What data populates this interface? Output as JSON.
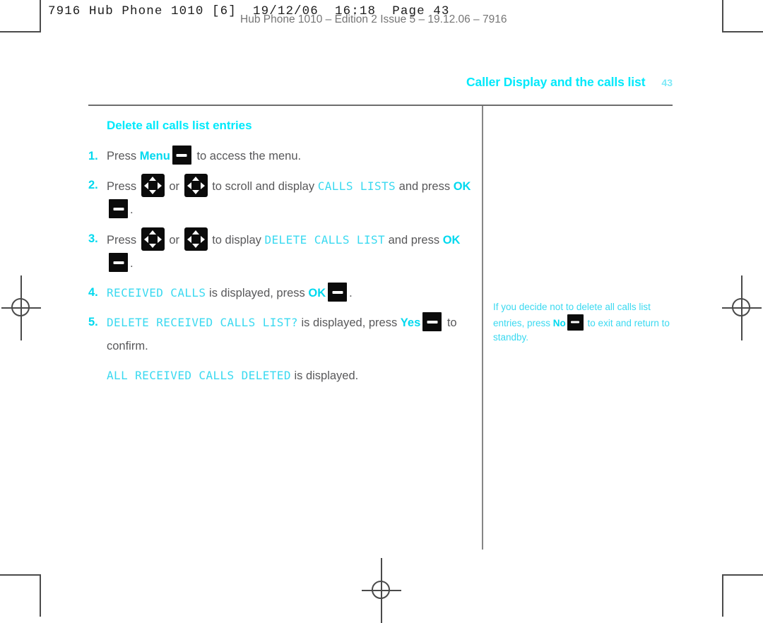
{
  "printer_slug": "7916 Hub Phone 1010 [6]  19/12/06  16:18  Page 43",
  "footer_ghost": "Hub Phone 1010 – Edition 2 Issue 5 – 19.12.06 – 7916",
  "running_head": {
    "title": "Caller Display and the calls list",
    "folio": "43"
  },
  "section": {
    "title": "Delete all calls list entries"
  },
  "steps": [
    {
      "number": "1.",
      "parts": [
        {
          "type": "text",
          "value": "Press "
        },
        {
          "type": "em",
          "value": "Menu"
        },
        {
          "type": "key",
          "value": "flat-key"
        },
        {
          "type": "text",
          "value": " to access the menu."
        }
      ]
    },
    {
      "number": "2.",
      "parts": [
        {
          "type": "text",
          "value": "Press "
        },
        {
          "type": "navkey",
          "value": "nav-key-up"
        },
        {
          "type": "text",
          "value": " or "
        },
        {
          "type": "navkey",
          "value": "nav-key-down"
        },
        {
          "type": "text",
          "value": " to scroll and display "
        },
        {
          "type": "lcd",
          "value": "CALLS LISTS"
        },
        {
          "type": "text",
          "value": " and press "
        },
        {
          "type": "em",
          "value": "OK"
        },
        {
          "type": "key",
          "value": "flat-key"
        },
        {
          "type": "text",
          "value": "."
        }
      ]
    },
    {
      "number": "3.",
      "parts": [
        {
          "type": "text",
          "value": "Press "
        },
        {
          "type": "navkey",
          "value": "nav-key-up"
        },
        {
          "type": "text",
          "value": " or "
        },
        {
          "type": "navkey",
          "value": "nav-key-down"
        },
        {
          "type": "text",
          "value": " to display "
        },
        {
          "type": "lcd",
          "value": "DELETE CALLS LIST"
        },
        {
          "type": "text",
          "value": " and press "
        },
        {
          "type": "em",
          "value": "OK"
        },
        {
          "type": "key",
          "value": "flat-key"
        },
        {
          "type": "text",
          "value": "."
        }
      ]
    },
    {
      "number": "4.",
      "parts": [
        {
          "type": "lcd",
          "value": "RECEIVED CALLS"
        },
        {
          "type": "text",
          "value": " is displayed, press "
        },
        {
          "type": "em",
          "value": "OK"
        },
        {
          "type": "key",
          "value": "flat-key"
        },
        {
          "type": "text",
          "value": "."
        }
      ]
    },
    {
      "number": "5.",
      "parts": [
        {
          "type": "lcd",
          "value": "DELETE RECEIVED CALLS LIST?"
        },
        {
          "type": "text",
          "value": " is displayed, press "
        },
        {
          "type": "em",
          "value": "Yes"
        },
        {
          "type": "key",
          "value": "flat-key"
        },
        {
          "type": "text",
          "value": " to confirm."
        }
      ]
    }
  ],
  "closing_line": {
    "parts": [
      {
        "type": "lcd",
        "value": "ALL RECEIVED CALLS DELETED"
      },
      {
        "type": "text",
        "value": " is displayed."
      }
    ]
  },
  "side_note": {
    "parts": [
      {
        "type": "text",
        "value": "If you decide not to delete all calls list entries, press "
      },
      {
        "type": "em",
        "value": "No"
      },
      {
        "type": "key",
        "value": "flat-key"
      },
      {
        "type": "text",
        "value": " to exit and return to standby."
      }
    ]
  },
  "colors": {
    "accent_cyan": "#00e9fb",
    "lcd_cyan": "#3ad9f0",
    "body_grey": "#58585a",
    "rule_grey": "#6d6d6d",
    "key_black": "#0b0b0b"
  }
}
